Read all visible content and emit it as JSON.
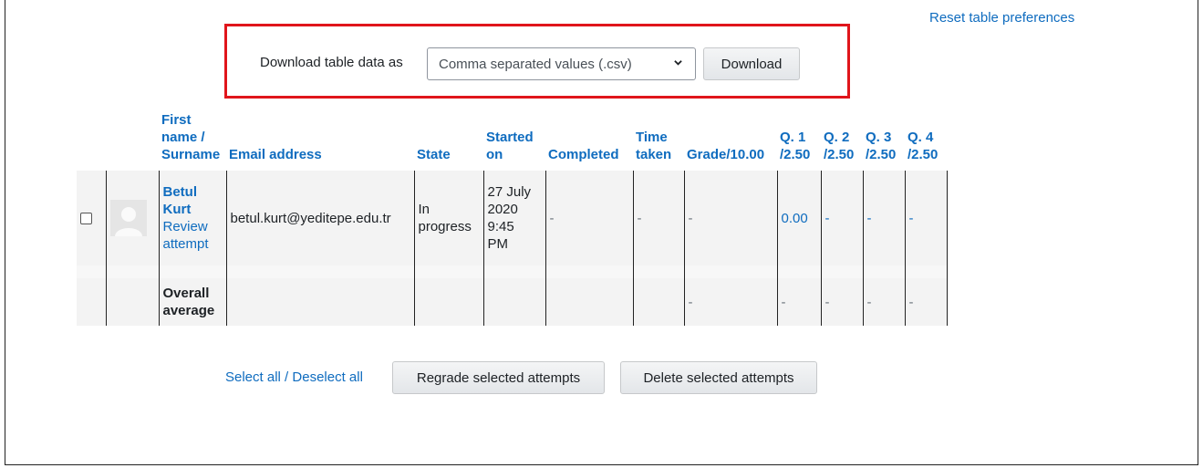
{
  "reset_label": "Reset table preferences",
  "download": {
    "label": "Download table data as",
    "format_selected": "Comma separated values (.csv)",
    "button": "Download"
  },
  "table": {
    "headers": {
      "name_1": "First",
      "name_2": "name /",
      "name_3": "Surname",
      "email": "Email address",
      "state": "State",
      "started_1": "Started",
      "started_2": "on",
      "completed": "Completed",
      "time_1": "Time",
      "time_2": "taken",
      "grade": "Grade/10.00",
      "q1_1": "Q. 1",
      "q1_2": "/2.50",
      "q2_1": "Q. 2",
      "q2_2": "/2.50",
      "q3_1": "Q. 3",
      "q3_2": "/2.50",
      "q4_1": "Q. 4",
      "q4_2": "/2.50"
    },
    "row": {
      "first_1": "Betul",
      "first_2": "Kurt",
      "review_1": "Review",
      "review_2": "attempt",
      "email": "betul.kurt@yeditepe.edu.tr",
      "state_1": "In",
      "state_2": "progress",
      "started_1": "27 July",
      "started_2": "2020",
      "started_3": "9:45",
      "started_4": "PM",
      "completed": "-",
      "time": "-",
      "grade": "-",
      "q1": "0.00",
      "q2": "-",
      "q3": "-",
      "q4": "-"
    },
    "average": {
      "label_1": "Overall",
      "label_2": "average",
      "grade": "-",
      "q1": "-",
      "q2": "-",
      "q3": "-",
      "q4": "-"
    }
  },
  "actions": {
    "select_all": "Select all",
    "separator": " / ",
    "deselect_all": "Deselect all",
    "regrade": "Regrade selected attempts",
    "delete": "Delete selected attempts"
  }
}
